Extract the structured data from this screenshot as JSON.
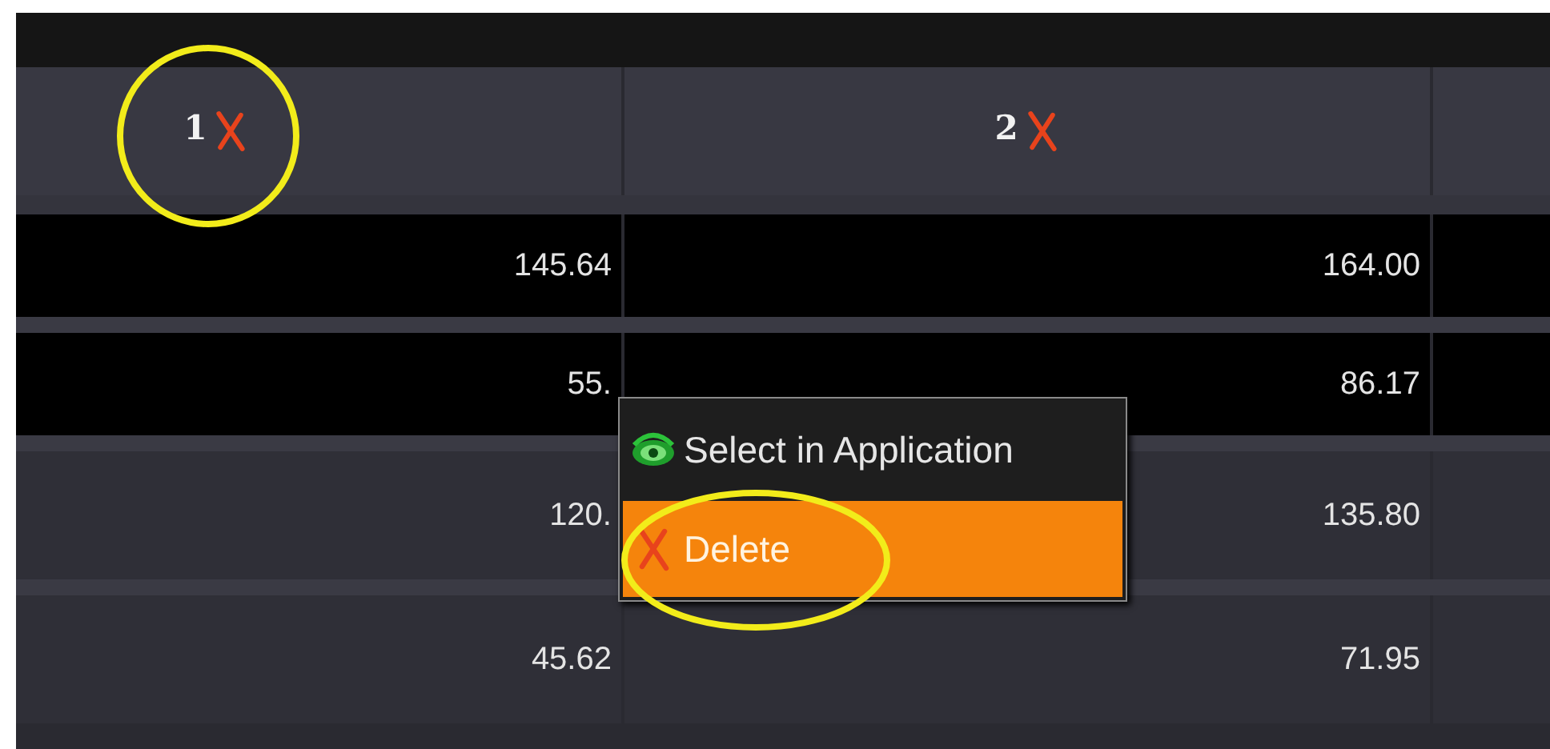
{
  "columns": [
    {
      "label": "1"
    },
    {
      "label": "2"
    }
  ],
  "rows": [
    {
      "kind": "dark",
      "cells": [
        "145.64",
        "164.00"
      ]
    },
    {
      "kind": "dark",
      "cells": [
        "55.",
        "86.17"
      ]
    },
    {
      "kind": "light",
      "cells": [
        "120.",
        "135.80"
      ]
    },
    {
      "kind": "light",
      "cells": [
        "45.62",
        "71.95"
      ]
    }
  ],
  "context_menu": {
    "items": [
      {
        "kind": "select",
        "label": "Select in Application",
        "selected": false
      },
      {
        "kind": "delete",
        "label": "Delete",
        "selected": true
      }
    ]
  }
}
